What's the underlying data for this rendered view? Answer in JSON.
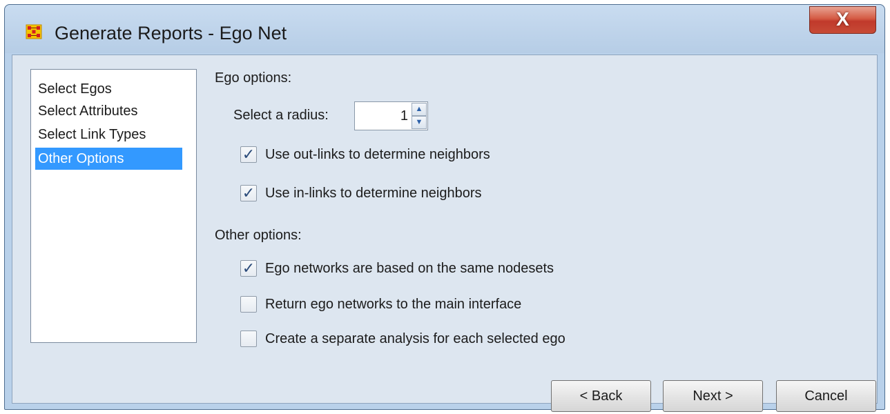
{
  "window": {
    "title": "Generate Reports - Ego Net",
    "app_icon": "network-grid-icon",
    "close_label": "X"
  },
  "nav": {
    "items": [
      {
        "label": "Select Egos",
        "selected": false
      },
      {
        "label": "Select Attributes",
        "selected": false
      },
      {
        "label": "Select Link Types",
        "selected": false
      },
      {
        "label": "Other Options",
        "selected": true
      }
    ]
  },
  "ego_options": {
    "heading": "Ego options:",
    "radius_label": "Select a radius:",
    "radius_value": "1",
    "out_links": {
      "label": "Use out-links to determine neighbors",
      "checked": true
    },
    "in_links": {
      "label": "Use in-links to determine neighbors",
      "checked": true
    }
  },
  "other_options": {
    "heading": "Other options:",
    "same_nodesets": {
      "label": "Ego networks are based on the same nodesets",
      "checked": true
    },
    "return_main": {
      "label": "Return ego networks to the main interface",
      "checked": false
    },
    "separate_analysis": {
      "label": "Create a separate analysis for each selected ego",
      "checked": false
    }
  },
  "buttons": {
    "back": "< Back",
    "next": "Next >",
    "cancel": "Cancel"
  },
  "colors": {
    "selection": "#3399ff",
    "close_button": "#c94a36",
    "window_frame": "#b9d1ea"
  }
}
